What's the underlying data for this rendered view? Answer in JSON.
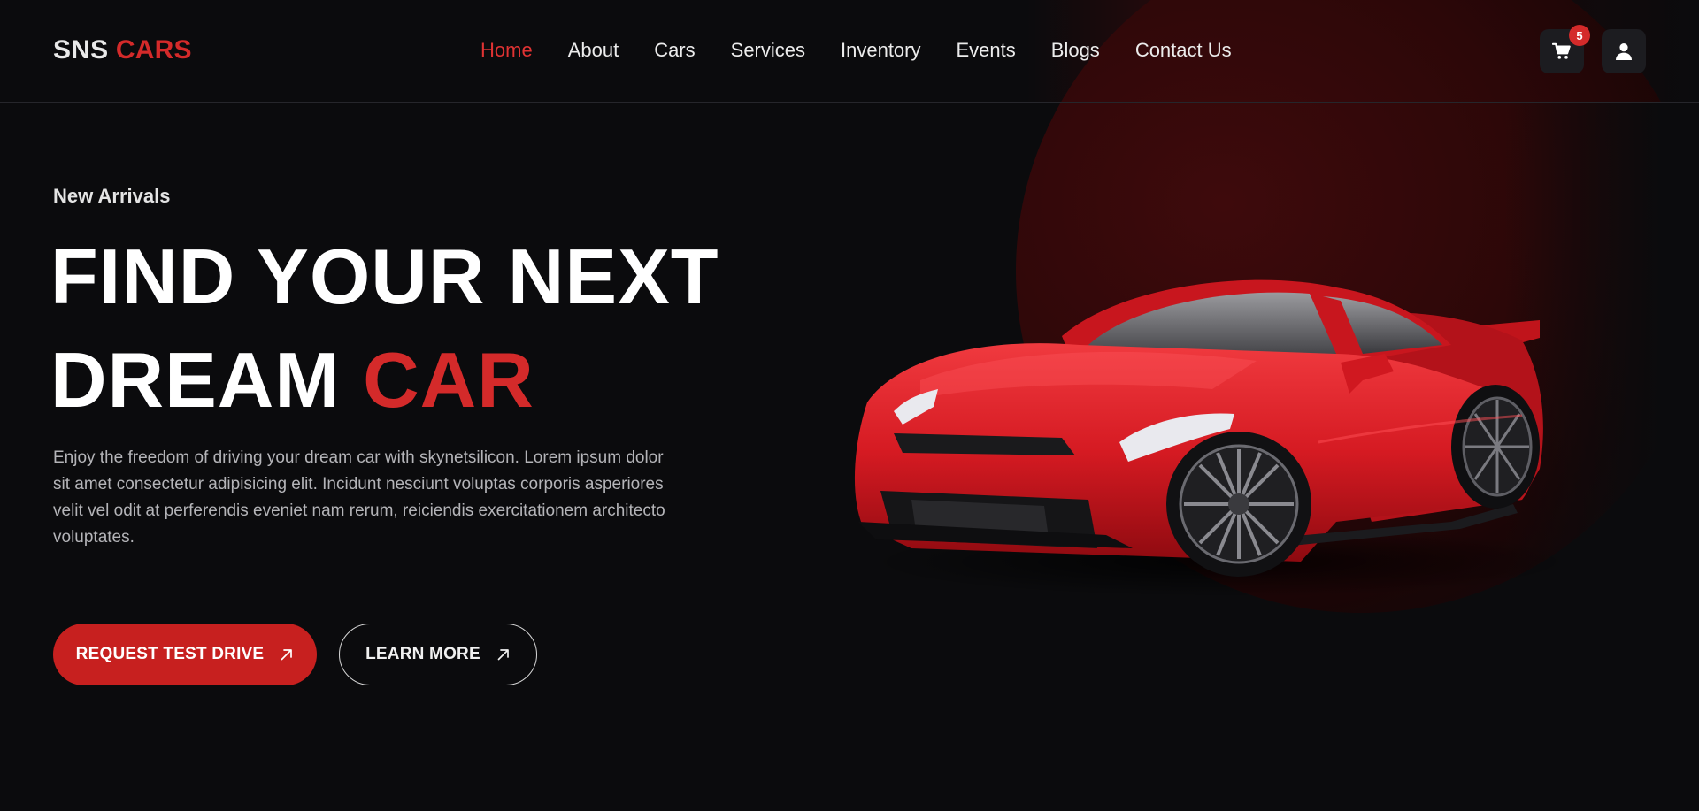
{
  "brand": {
    "part1": "SNS",
    "part2": "CARS"
  },
  "nav": {
    "items": [
      {
        "label": "Home",
        "active": true
      },
      {
        "label": "About"
      },
      {
        "label": "Cars"
      },
      {
        "label": "Services"
      },
      {
        "label": "Inventory"
      },
      {
        "label": "Events"
      },
      {
        "label": "Blogs"
      },
      {
        "label": "Contact Us"
      }
    ]
  },
  "header_actions": {
    "cart": {
      "icon": "cart-icon",
      "count": "5"
    },
    "account": {
      "icon": "user-icon"
    }
  },
  "hero": {
    "eyebrow": "New Arrivals",
    "headline_line1": "FIND YOUR NEXT",
    "headline_line2_white": "DREAM",
    "headline_line2_red": "CAR",
    "description": "Enjoy the freedom of driving your dream car with skynetsilicon. Lorem ipsum dolor sit amet consectetur adipisicing elit. Incidunt nesciunt voluptas corporis asperiores velit vel odit at perferendis eveniet nam rerum, reiciendis exercitationem architecto voluptates.",
    "primary_button": "REQUEST TEST DRIVE",
    "secondary_button": "LEARN MORE",
    "button_icon": "arrow-up-right-icon",
    "image": "red-sports-car"
  },
  "colors": {
    "accent": "#d42a2a",
    "background": "#0b0b0d",
    "primary_button": "#c7201f"
  }
}
